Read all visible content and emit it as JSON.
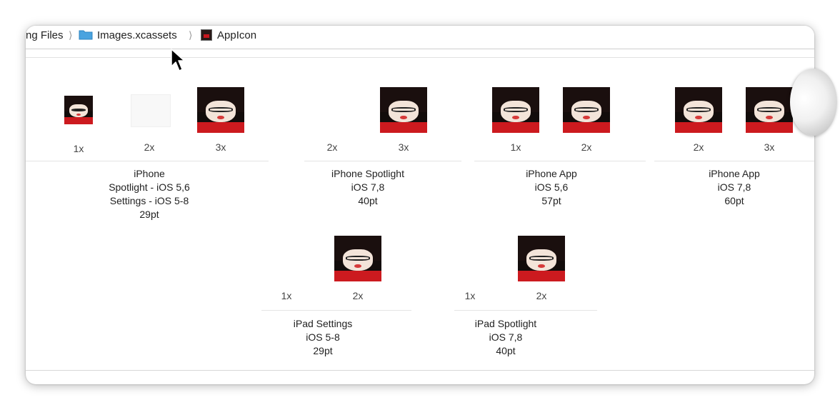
{
  "breadcrumb": {
    "items": [
      {
        "label": "ng Files"
      },
      {
        "label": "Images.xcassets"
      },
      {
        "label": "AppIcon"
      }
    ],
    "separator": "⟩"
  },
  "groups": [
    {
      "scales": [
        "1x",
        "2x",
        "3x"
      ],
      "lines": [
        "iPhone",
        "Spotlight - iOS 5,6",
        "Settings - iOS 5-8",
        "29pt"
      ]
    },
    {
      "scales": [
        "2x",
        "3x"
      ],
      "lines": [
        "iPhone Spotlight",
        "iOS 7,8",
        "40pt"
      ]
    },
    {
      "scales": [
        "1x",
        "2x"
      ],
      "lines": [
        "iPhone App",
        "iOS 5,6",
        "57pt"
      ]
    },
    {
      "scales": [
        "2x",
        "3x"
      ],
      "lines": [
        "iPhone App",
        "iOS 7,8",
        "60pt"
      ]
    },
    {
      "scales": [
        "1x",
        "2x"
      ],
      "lines": [
        "iPad Settings",
        "iOS 5-8",
        "29pt"
      ]
    },
    {
      "scales": [
        "1x",
        "2x"
      ],
      "lines": [
        "iPad Spotlight",
        "iOS 7,8",
        "40pt"
      ]
    }
  ],
  "colors": {
    "folder": "#4aa3df",
    "shirt": "#cc1a1f"
  },
  "icons": {
    "folder": "folder-icon",
    "asset": "appicon-asset-icon",
    "cursor": "mouse-pointer-icon"
  }
}
